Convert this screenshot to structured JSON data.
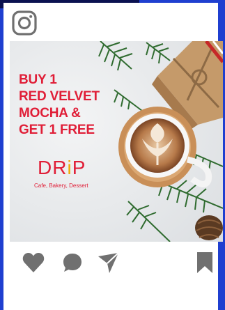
{
  "post": {
    "headline": [
      "BUY 1",
      "RED VELVET",
      "MOCHA &",
      "GET 1 FREE"
    ],
    "brand": {
      "pre": "DR",
      "accent": "i",
      "post": "P"
    },
    "tagline": "Cafe, Bakery, Dessert"
  },
  "icons": {
    "app": "instagram-icon",
    "like": "heart-icon",
    "comment": "comment-icon",
    "share": "send-icon",
    "save": "bookmark-icon"
  },
  "colors": {
    "brand_red": "#e01e37",
    "brand_accent": "#f2a900",
    "icon_gray": "#707070",
    "background_blue": "#1f3fd0"
  }
}
